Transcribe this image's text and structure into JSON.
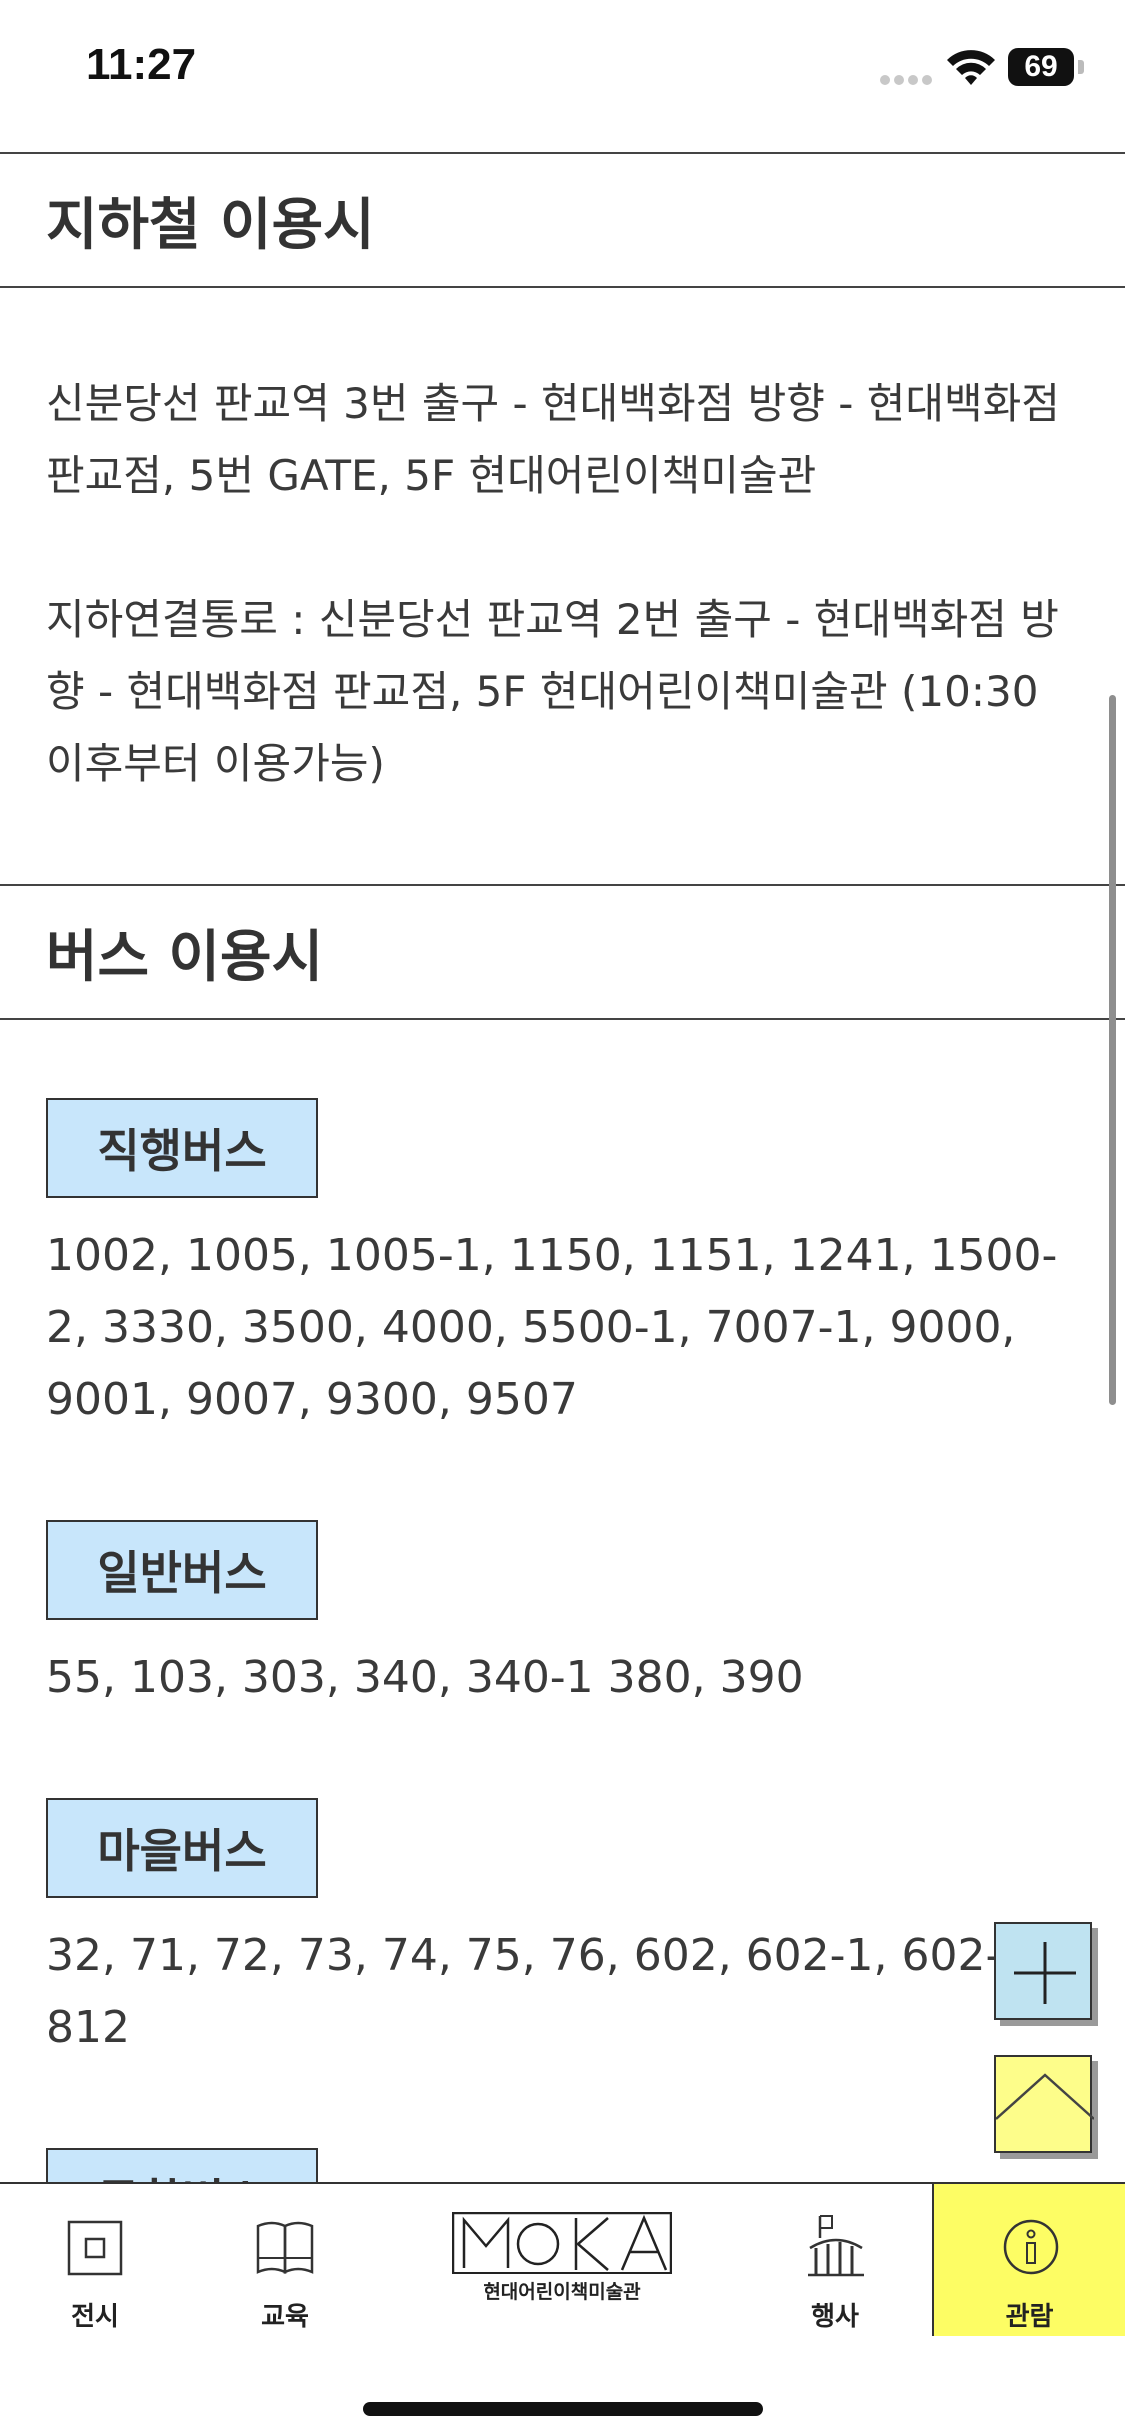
{
  "status_bar": {
    "time": "11:27",
    "battery": "69"
  },
  "subway": {
    "heading": "지하철 이용시",
    "para1": "신분당선 판교역 3번 출구 - 현대백화점 방향 - 현대백화점 판교점, 5번 GATE, 5F 현대어린이책미술관",
    "para2": "지하연결통로 : 신분당선 판교역 2번 출구 - 현대백화점 방향 - 현대백화점 판교점, 5F 현대어린이책미술관 (10:30 이후부터 이용가능)"
  },
  "bus": {
    "heading": "버스 이용시",
    "groups": [
      {
        "label": "직행버스",
        "numbers": "1002, 1005, 1005-1, 1150, 1151, 1241, 1500-2, 3330, 3500, 4000, 5500-1, 7007-1, 9000, 9001, 9007, 9300, 9507"
      },
      {
        "label": "일반버스",
        "numbers": "55, 103, 303, 340, 340-1 380, 390"
      },
      {
        "label": "마을버스",
        "numbers": "32, 71, 72, 73, 74, 75, 76, 602, 602-1, 602-2, 812"
      },
      {
        "label": "공항버스",
        "numbers": ""
      }
    ]
  },
  "bottom_nav": {
    "exhibit": "전시",
    "education": "교육",
    "logo_letters": "MOKA",
    "logo_text": "현대어린이책미술관",
    "event": "행사",
    "visit": "관람"
  },
  "colors": {
    "badge_bg": "#c8e6fb",
    "active_tab_bg": "#fdfd64",
    "plus_button_bg": "#bfe3f1",
    "top_button_bg": "#fdfd8a"
  }
}
